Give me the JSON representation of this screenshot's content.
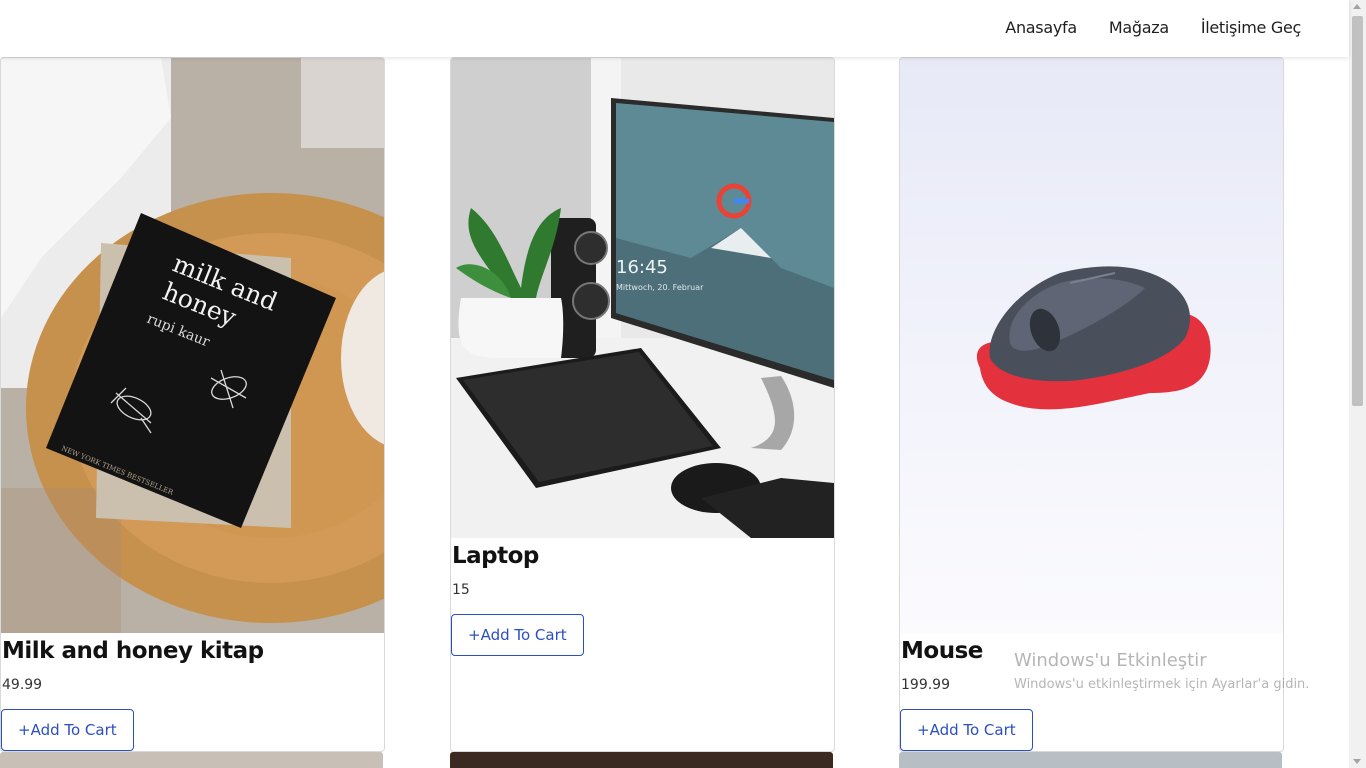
{
  "nav": {
    "links": [
      "Anasayfa",
      "Mağaza",
      "İletişime Geç"
    ]
  },
  "products": [
    {
      "name": "Milk and honey kitap",
      "price": "49.99",
      "button": "+Add To Cart",
      "image": "milk-and-honey-book-photo"
    },
    {
      "name": "Laptop",
      "price": "15",
      "button": "+Add To Cart",
      "image": "desk-monitor-keyboard-photo"
    },
    {
      "name": "Mouse",
      "price": "199.99",
      "button": "+Add To Cart",
      "image": "computer-mouse-photo"
    }
  ],
  "book_cover": {
    "title_line1": "milk and",
    "title_line2": "honey",
    "author": "rupi kaur",
    "tagline": "NEW YORK TIMES BESTSELLER"
  },
  "monitor": {
    "time": "16:45",
    "date": "Mittwoch, 20. Februar"
  },
  "watermark": {
    "title": "Windows'u Etkinleştir",
    "subtitle": "Windows'u etkinleştirmek için Ayarlar'a gidin."
  }
}
